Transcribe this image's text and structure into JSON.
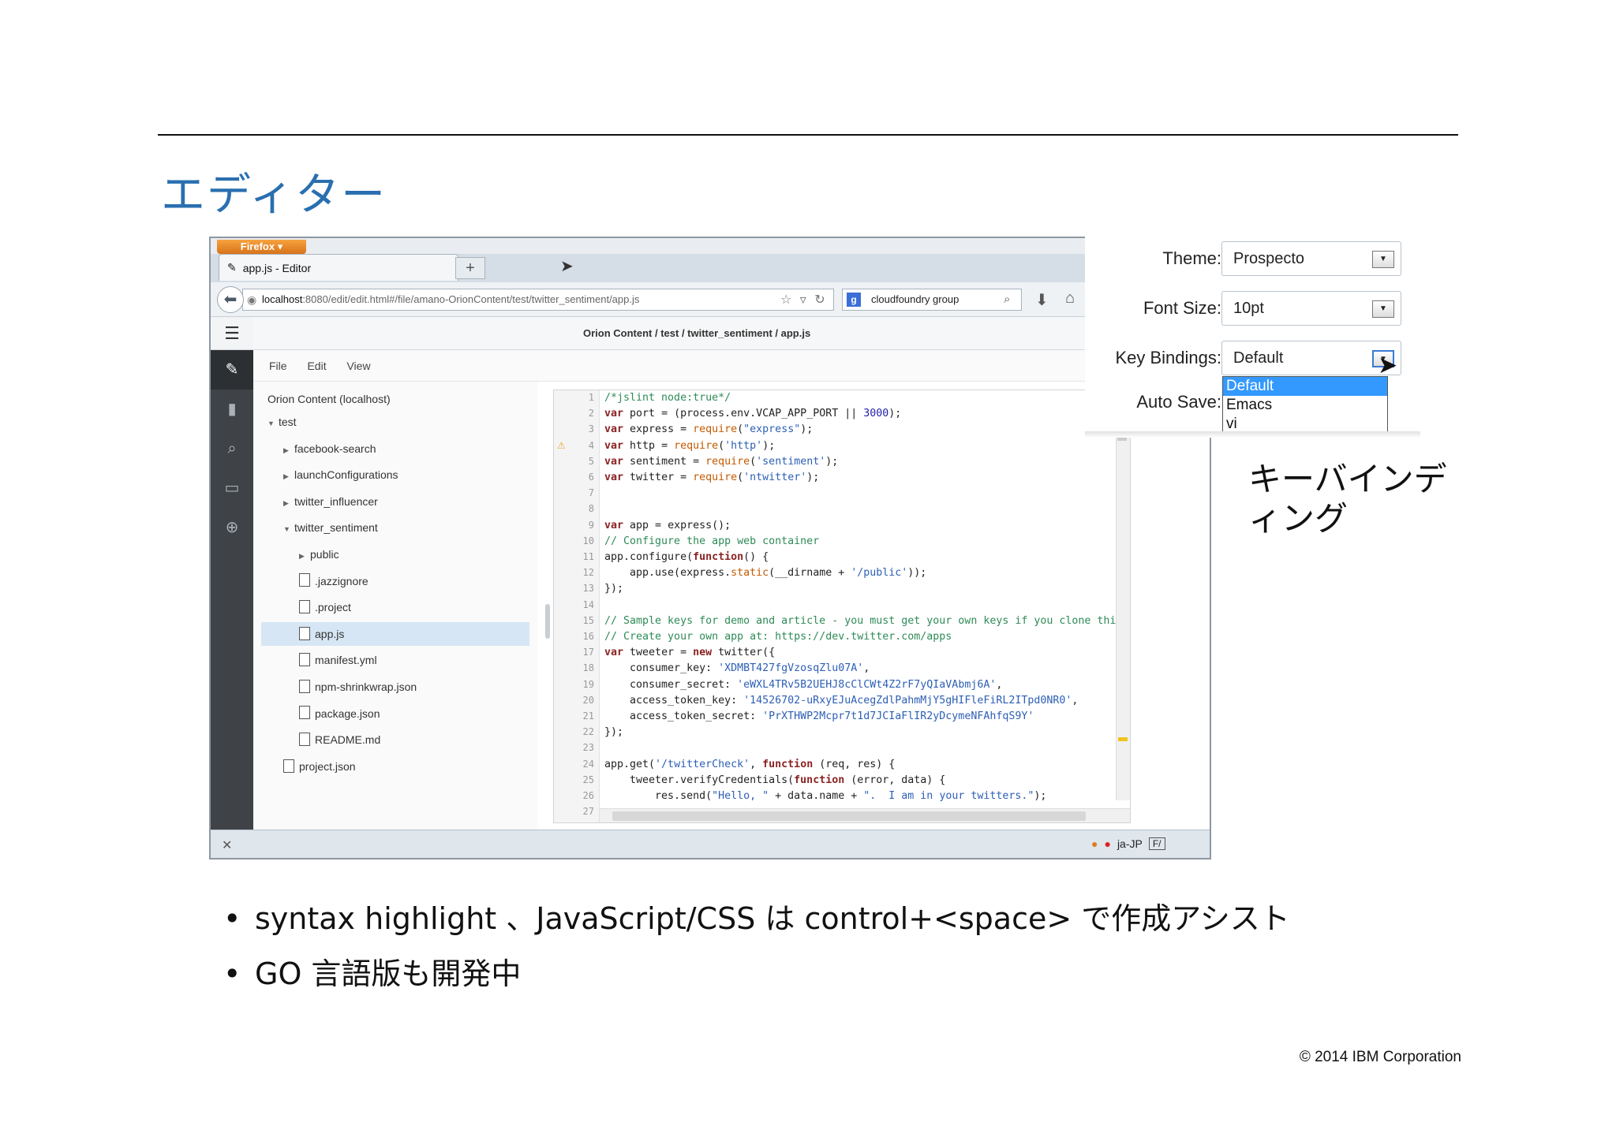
{
  "slide": {
    "title": "エディター",
    "bullets": [
      "syntax highlight 、JavaScript/CSS は control+<space> で作成アシスト",
      "GO 言語版も開発中"
    ],
    "copyright": "© 2014 IBM Corporation",
    "caption": "キーバインディング"
  },
  "browser": {
    "menu_button": "Firefox ▾",
    "tab_title": "app.js - Editor",
    "new_tab": "+",
    "url_host": "localhost",
    "url_path": ":8080/edit/edit.html#/file/amano-OrionContent/test/twitter_sentiment/app.js",
    "search_text": "cloudfoundry group",
    "status_locale": "ja-JP"
  },
  "orion": {
    "breadcrumb": "Orion Content / test / twitter_sentiment / app.js",
    "menu": [
      "File",
      "Edit",
      "View"
    ],
    "tree_root": "Orion Content (localhost)",
    "tree": [
      {
        "label": "test",
        "type": "folder-open",
        "indent": 0
      },
      {
        "label": "facebook-search",
        "type": "folder",
        "indent": 1
      },
      {
        "label": "launchConfigurations",
        "type": "folder",
        "indent": 1
      },
      {
        "label": "twitter_influencer",
        "type": "folder",
        "indent": 1
      },
      {
        "label": "twitter_sentiment",
        "type": "folder-open",
        "indent": 1
      },
      {
        "label": "public",
        "type": "folder",
        "indent": 2
      },
      {
        "label": ".jazzignore",
        "type": "file",
        "indent": 2
      },
      {
        "label": ".project",
        "type": "file",
        "indent": 2
      },
      {
        "label": "app.js",
        "type": "file",
        "indent": 2,
        "selected": true
      },
      {
        "label": "manifest.yml",
        "type": "file",
        "indent": 2
      },
      {
        "label": "npm-shrinkwrap.json",
        "type": "file",
        "indent": 2
      },
      {
        "label": "package.json",
        "type": "file",
        "indent": 2
      },
      {
        "label": "README.md",
        "type": "file",
        "indent": 2
      },
      {
        "label": "project.json",
        "type": "file",
        "indent": 1
      }
    ],
    "code_lines": [
      "/*jslint node:true*/",
      "var port = (process.env.VCAP_APP_PORT || 3000);",
      "var express = require(\"express\");",
      "var http = require('http');",
      "var sentiment = require('sentiment');",
      "var twitter = require('ntwitter');",
      "",
      "",
      "var app = express();",
      "// Configure the app web container",
      "app.configure(function() {",
      "    app.use(express.static(__dirname + '/public'));",
      "});",
      "",
      "// Sample keys for demo and article - you must get your own keys if you clone this app",
      "// Create your own app at: https://dev.twitter.com/apps",
      "var tweeter = new twitter({",
      "    consumer_key: 'XDMBT427fgVzosqZlu07A',",
      "    consumer_secret: 'eWXL4TRv5B2UEHJ8cClCWt4Z2rF7yQIaVAbmj6A',",
      "    access_token_key: '14526702-uRxyEJuAcegZdlPahmMjY5gHIFleFiRL2ITpd0NR0',",
      "    access_token_secret: 'PrXTHWP2Mcpr7t1d7JCIaFlIR2yDcymeNFAhfqS9Y'",
      "});",
      "",
      "app.get('/twitterCheck', function (req, res) {",
      "    tweeter.verifyCredentials(function (error, data) {",
      "        res.send(\"Hello, \" + data.name + \".  I am in your twitters.\");",
      ""
    ],
    "warning_line": 4
  },
  "settings": {
    "theme_label": "Theme:",
    "theme_value": "Prospecto",
    "font_size_label": "Font Size:",
    "font_size_value": "10pt",
    "key_bindings_label": "Key Bindings:",
    "key_bindings_value": "Default",
    "auto_save_label": "Auto Save:",
    "key_binding_options": [
      "Default",
      "Emacs",
      "vi"
    ]
  },
  "colors": {
    "title_blue": "#2a6fb0",
    "sidebar_dark": "#3f4347",
    "selection_blue": "#3399ff"
  }
}
